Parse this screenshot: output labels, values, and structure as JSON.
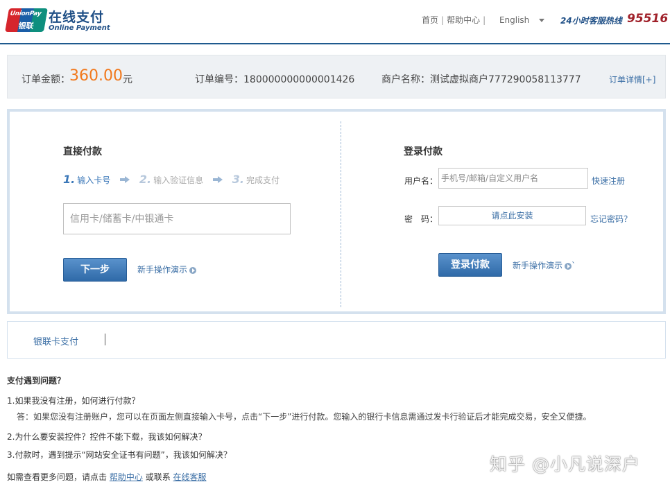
{
  "header": {
    "logo_text_en": "UnionPay",
    "logo_text_cn": "银联",
    "brand_cn": "在线支付",
    "brand_en": "Online Payment",
    "nav": {
      "home": "首页",
      "help": "帮助中心",
      "language": "English"
    },
    "hotline_label": "24小时客服热线",
    "hotline_number": "95516"
  },
  "order": {
    "amount_label": "订单金额：",
    "amount": "360.00",
    "currency": "元",
    "order_no": "订单编号：180000000000001426",
    "merchant": "商户名称：测试虚拟商户777290058113777",
    "detail_link": "订单详情[+]"
  },
  "direct_pay": {
    "title": "直接付款",
    "steps": [
      {
        "num": "1.",
        "label": "输入卡号"
      },
      {
        "num": "2.",
        "label": "输入验证信息"
      },
      {
        "num": "3.",
        "label": "完成支付"
      }
    ],
    "card_placeholder": "信用卡/储蓄卡/中银通卡",
    "next_button": "下一步",
    "demo_link": "新手操作演示"
  },
  "login_pay": {
    "title": "登录付款",
    "username_label": "用户名：",
    "username_placeholder": "手机号/邮箱/自定义用户名",
    "register_link": "快速注册",
    "password_label": "密　码：",
    "password_install": "请点此安装",
    "forgot_link": "忘记密码？",
    "login_button": "登录付款",
    "demo_link": "新手操作演示",
    "demo_suffix": "`"
  },
  "tabs": {
    "unionpay_card": "银联卡支付"
  },
  "faq": {
    "title": "支付遇到问题？",
    "q1": "1.如果我没有注册，如何进行付款？",
    "a1": "答：如果您没有注册账户，您可以在页面左侧直接输入卡号，点击“下一步”进行付款。您输入的银行卡信息需通过发卡行验证后才能完成交易，安全又便捷。",
    "q2": "2.为什么要安装控件？控件不能下载，我该如何解决？",
    "q3": "3.付款时，遇到提示“网站安全证书有问题”，我该如何解决？",
    "more_prefix": "如需查看更多问题，请点击",
    "help_center_link": "帮助中心",
    "more_middle": "或联系",
    "online_service_link": "在线客服"
  },
  "watermark": "知乎 @小凡说深户",
  "colors": {
    "brand_blue": "#1f4f86",
    "amount_orange": "#f1781c",
    "link_blue": "#3a6ea5",
    "hotline_red": "#a0212a"
  }
}
